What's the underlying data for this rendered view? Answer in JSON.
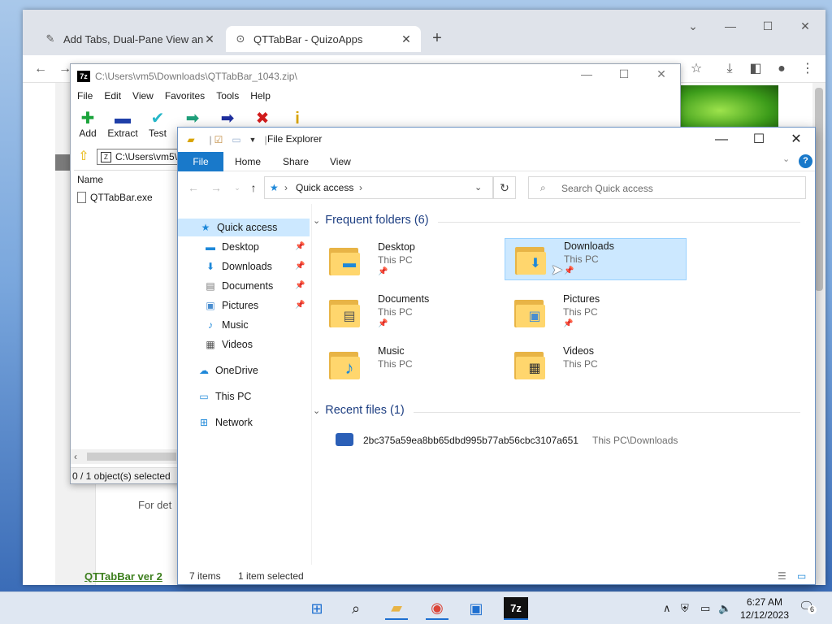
{
  "browser": {
    "tabs": [
      {
        "label": "Add Tabs, Dual-Pane View and A",
        "icon": "kquizo-icon"
      },
      {
        "label": "QTTabBar - QuizoApps",
        "icon": "qttabbar-icon"
      }
    ],
    "page": {
      "text_fragment": "For det",
      "link_fragment": "QTTabBar ver 2"
    }
  },
  "zip": {
    "title": "C:\\Users\\vm5\\Downloads\\QTTabBar_1043.zip\\",
    "menu": [
      "File",
      "Edit",
      "View",
      "Favorites",
      "Tools",
      "Help"
    ],
    "toolbar": [
      {
        "label": "Add",
        "glyph": "✚",
        "color": "#1aa33a"
      },
      {
        "label": "Extract",
        "glyph": "▬",
        "color": "#1f3fa8"
      },
      {
        "label": "Test",
        "glyph": "✔",
        "color": "#26b7c8"
      },
      {
        "label": "",
        "glyph": "➡",
        "color": "#1f9f7a"
      },
      {
        "label": "",
        "glyph": "➡",
        "color": "#1f2f9e"
      },
      {
        "label": "",
        "glyph": "✖",
        "color": "#d21c1c"
      },
      {
        "label": "",
        "glyph": "i",
        "color": "#d9a400"
      }
    ],
    "path": "C:\\Users\\vm5\\",
    "column": "Name",
    "file": "QTTabBar.exe",
    "status": "0 / 1 object(s) selected"
  },
  "explorer": {
    "title": "File Explorer",
    "ribbon_tabs": {
      "file": "File",
      "home": "Home",
      "share": "Share",
      "view": "View"
    },
    "address": "Quick access",
    "search_placeholder": "Search Quick access",
    "nav": [
      {
        "label": "Quick access",
        "icon": "star-icon",
        "selected": true,
        "pinned": false
      },
      {
        "label": "Desktop",
        "icon": "desktop-icon",
        "pinned": true
      },
      {
        "label": "Downloads",
        "icon": "download-icon",
        "pinned": true
      },
      {
        "label": "Documents",
        "icon": "documents-icon",
        "pinned": true
      },
      {
        "label": "Pictures",
        "icon": "pictures-icon",
        "pinned": true
      },
      {
        "label": "Music",
        "icon": "music-icon",
        "pinned": false
      },
      {
        "label": "Videos",
        "icon": "videos-icon",
        "pinned": false
      },
      {
        "label": "OneDrive",
        "icon": "cloud-icon",
        "pinned": false
      },
      {
        "label": "This PC",
        "icon": "pc-icon",
        "pinned": false
      },
      {
        "label": "Network",
        "icon": "network-icon",
        "pinned": false
      }
    ],
    "frequent_header": "Frequent folders (6)",
    "folders": [
      {
        "name": "Desktop",
        "location": "This PC",
        "pinned": true
      },
      {
        "name": "Downloads",
        "location": "This PC",
        "pinned": true,
        "selected": true
      },
      {
        "name": "Documents",
        "location": "This PC",
        "pinned": true
      },
      {
        "name": "Pictures",
        "location": "This PC",
        "pinned": true
      },
      {
        "name": "Music",
        "location": "This PC",
        "pinned": false
      },
      {
        "name": "Videos",
        "location": "This PC",
        "pinned": false
      }
    ],
    "recent_header": "Recent files (1)",
    "recent": [
      {
        "name": "2bc375a59ea8bb65dbd995b77ab56cbc3107a651",
        "path": "This PC\\Downloads"
      }
    ],
    "status": {
      "items": "7 items",
      "selected": "1 item selected"
    }
  },
  "taskbar": {
    "time": "6:27 AM",
    "date": "12/12/2023",
    "notifications": "6"
  }
}
